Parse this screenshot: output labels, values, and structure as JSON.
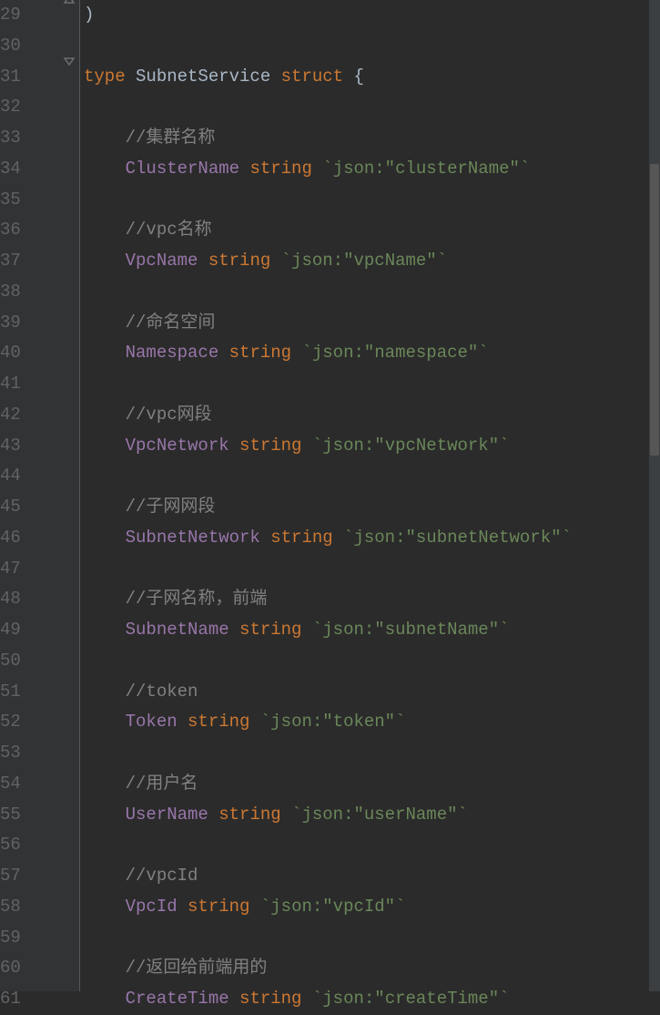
{
  "gutter": {
    "start": 29,
    "end": 61,
    "fold_icon_up_line": 29,
    "fold_icon_down_line": 31
  },
  "code": {
    "l29": ")",
    "c33": "//集群名称",
    "c36": "//vpc名称",
    "c39": "//命名空间",
    "c42": "//vpc网段",
    "c45": "//子网网段",
    "c48": "//子网名称，前端",
    "c51": "//token",
    "c54": "//用户名",
    "c57": "//vpcId",
    "c60": "//返回给前端用的",
    "kw_type": "type",
    "type_name": "SubnetService",
    "kw_struct": "struct",
    "brace_open": "{",
    "ty_string": "string",
    "f34_name": "ClusterName",
    "f34_tag": "`json:\"clusterName\"`",
    "f37_name": "VpcName",
    "f37_tag": "`json:\"vpcName\"`",
    "f40_name": "Namespace",
    "f40_tag": "`json:\"namespace\"`",
    "f43_name": "VpcNetwork",
    "f43_tag": "`json:\"vpcNetwork\"`",
    "f46_name": "SubnetNetwork",
    "f46_tag": "`json:\"subnetNetwork\"`",
    "f49_name": "SubnetName",
    "f49_tag": "`json:\"subnetName\"`",
    "f52_name": "Token",
    "f52_tag": "`json:\"token\"`",
    "f55_name": "UserName",
    "f55_tag": "`json:\"userName\"`",
    "f58_name": "VpcId",
    "f58_tag": "`json:\"vpcId\"`",
    "f61_name": "CreateTime",
    "f61_tag": "`json:\"createTime\"`"
  }
}
